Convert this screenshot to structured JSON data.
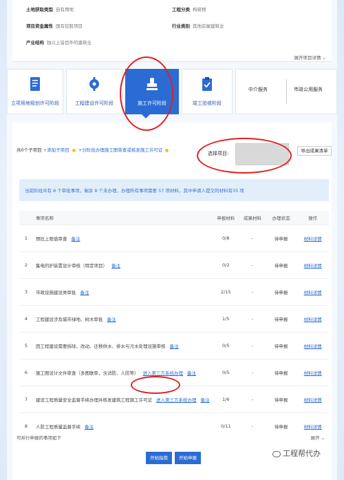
{
  "info": {
    "rows": [
      {
        "k": "土地获取类型",
        "v": "自有用地"
      },
      {
        "k": "工程分类",
        "v": "构筑物"
      },
      {
        "k": "项目资金属性",
        "v": "国有控股项目"
      },
      {
        "k": "行业类别",
        "v": "其他房屋建筑业"
      },
      {
        "k": "产业结构",
        "v": "独以上皆目外的建筑业"
      }
    ],
    "expand": "展开项目详情"
  },
  "stages": [
    {
      "label": "立项用地规划许可阶段",
      "icon": "document-icon"
    },
    {
      "label": "工程建设许可阶段",
      "icon": "gear-icon"
    },
    {
      "label": "施工许可阶段",
      "icon": "stamp-icon"
    },
    {
      "label": "竣工验收阶段",
      "icon": "clipboard-check-icon"
    }
  ],
  "services": {
    "a": "中介服务",
    "b": "市政公用服务"
  },
  "subitems": {
    "count": "共0个子项目",
    "add": "+添加子项目",
    "link": "+分阶段办理施工图审查或核发施工许可证"
  },
  "select": {
    "label": "选择项目:",
    "export": "导出成果清单"
  },
  "notice": "当前阶段共有 8 个审批事项，剩余 8 个未办理，办理所有事项需要 57 项材料，其中申请人提交的材料有35 项",
  "table": {
    "headers": [
      "事项名称",
      "申报材料",
      "成果材料",
      "办理状态",
      "操作"
    ],
    "rows": [
      {
        "n": "1",
        "name": "预拉上限值审查",
        "note": "备注",
        "ext": "",
        "m": "0/8",
        "r": "-",
        "s": "待申报",
        "op": "材料详情"
      },
      {
        "n": "2",
        "name": "集电的护装置设计审核（特定项目）",
        "note": "备注",
        "ext": "",
        "m": "0/2",
        "r": "-",
        "s": "待申报",
        "op": "材料详情"
      },
      {
        "n": "3",
        "name": "市政设施建设类审批",
        "note": "备注",
        "ext": "",
        "m": "2/15",
        "r": "-",
        "s": "待申报",
        "op": "材料详情"
      },
      {
        "n": "4",
        "name": "工程建设涉及城市绿地、树木审批",
        "note": "备注",
        "ext": "",
        "m": "1/5",
        "r": "-",
        "s": "待申报",
        "op": "材料详情"
      },
      {
        "n": "5",
        "name": "因工程建设需要拆除、改动、迁移供水、排水与污水处理设施审核",
        "note": "备注",
        "ext": "",
        "m": "0/5",
        "r": "-",
        "s": "待申报",
        "op": "材料详情"
      },
      {
        "n": "6",
        "name": "施工图设计文件审查（多图联审，含消防、人防等）",
        "note": "备注",
        "ext": "进入第三方系统办理",
        "m": "0/5",
        "r": "-",
        "s": "待申报",
        "op": "材料详情"
      },
      {
        "n": "7",
        "name": "建设工程质量安全监督手续办理并核发建筑工程施工许可证",
        "note": "备注",
        "ext": "进入第三方系统办理",
        "m": "1/6",
        "r": "-",
        "s": "待申报",
        "op": "材料详情"
      },
      {
        "n": "8",
        "name": "人防工程质量监督手续",
        "note": "备注",
        "ext": "",
        "m": "0/11",
        "r": "-",
        "s": "待申报",
        "op": "材料详情"
      }
    ]
  },
  "footer": {
    "parallel": "可并行申报的事项如下",
    "expand": "展开",
    "start_guide": "开始指南",
    "start_apply": "开始申报"
  },
  "watermark": "工程帮代办",
  "colors": {
    "accent": "#2b6cd4",
    "annotation": "#e02020"
  }
}
